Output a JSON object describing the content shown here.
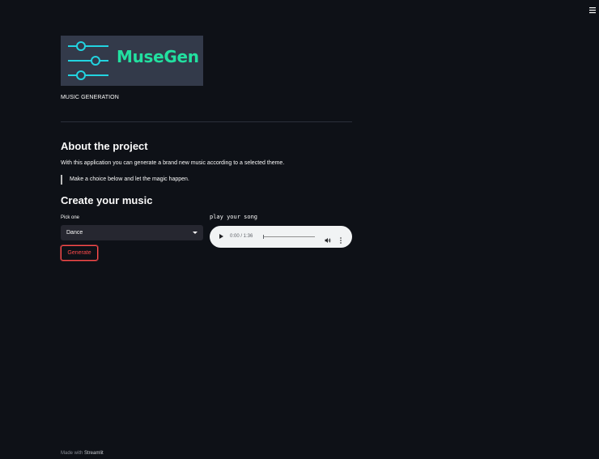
{
  "header": {
    "menu_icon": "hamburger-menu-icon"
  },
  "logo": {
    "text": "MuseGen",
    "icon": "equalizer-sliders-icon",
    "text_color": "#22e0a0",
    "slider_color": "#22d3e0"
  },
  "caption": "MUSIC GENERATION",
  "about": {
    "title": "About the project",
    "description": "With this application you can generate a brand new music according to a selected theme.",
    "quote": "Make a choice below and let the magic happen."
  },
  "create": {
    "title": "Create your music",
    "select_label": "Pick one",
    "select_value": "Dance",
    "audio_label": "play your song",
    "audio_time": "0:00 / 1:36",
    "generate_label": "Generate"
  },
  "footer": {
    "prefix": "Made with ",
    "link": "Streamlit"
  },
  "colors": {
    "background": "#0e1117",
    "accent": "#ff4b4b",
    "input_bg": "#262730"
  }
}
